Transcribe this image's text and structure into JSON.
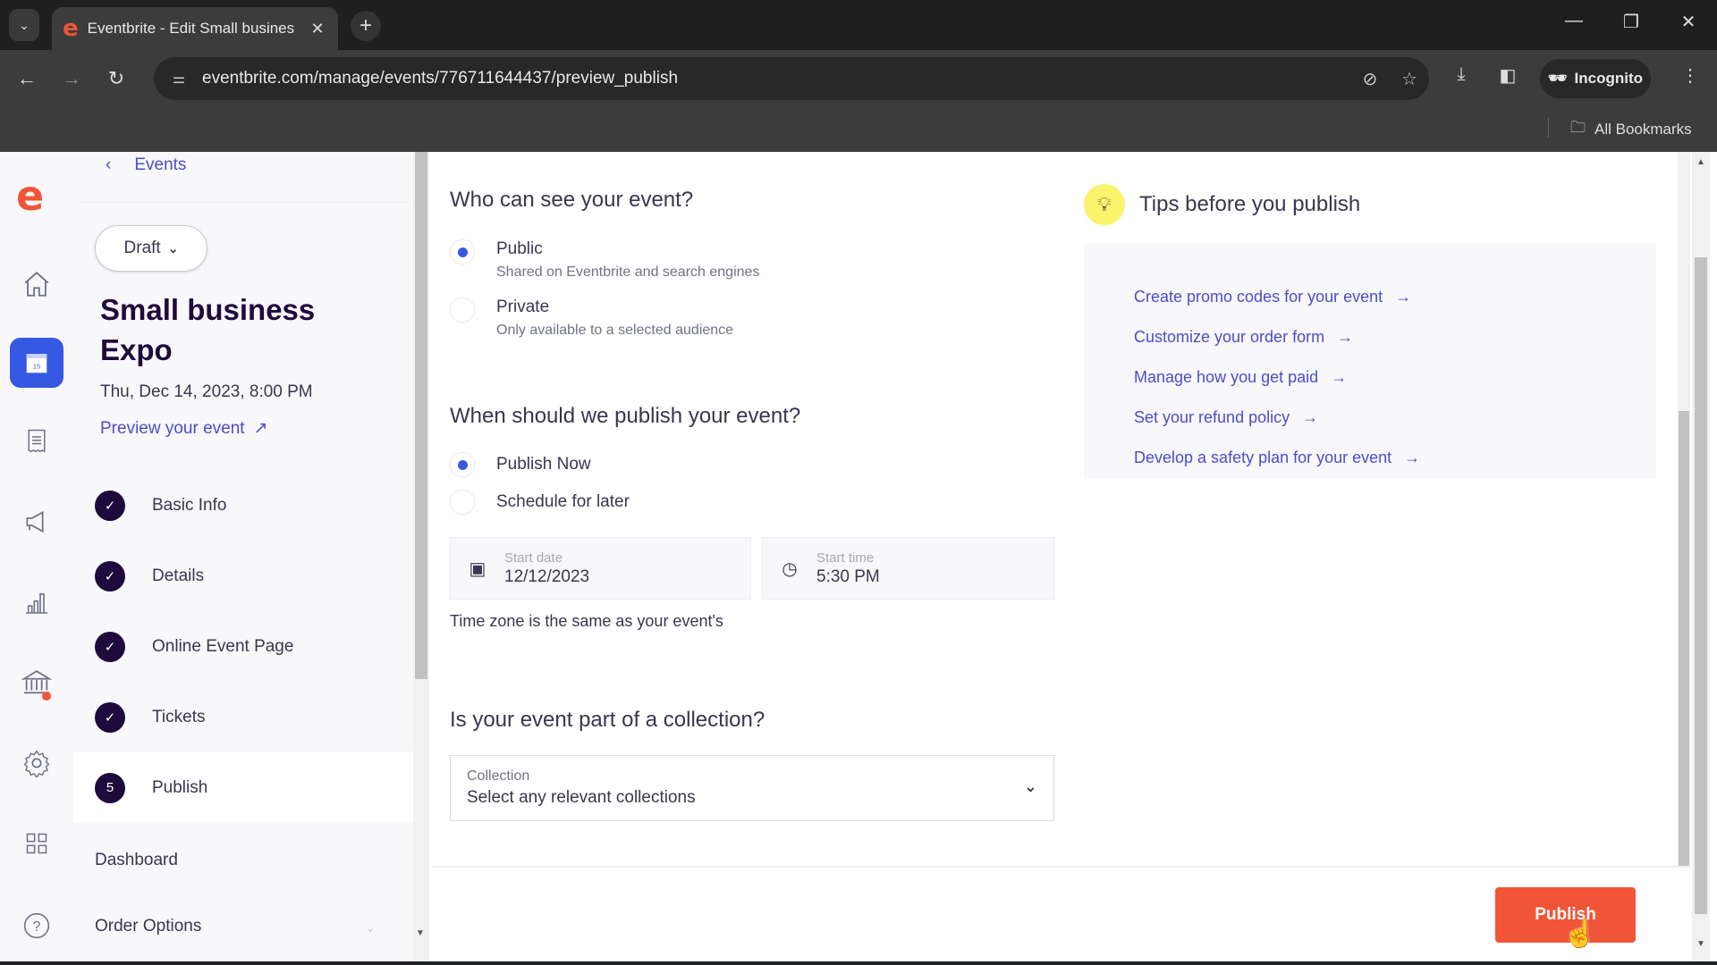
{
  "browser": {
    "tab_title": "Eventbrite - Edit Small busines",
    "tab_favicon": "e",
    "url": "eventbrite.com/manage/events/776711644437/preview_publish",
    "incognito_label": "Incognito",
    "bookmarks_label": "All Bookmarks",
    "icons": [
      "tab-search-icon",
      "close-icon",
      "new-tab-icon",
      "minimize-icon",
      "restore-icon",
      "close-window-icon",
      "back-icon",
      "forward-icon",
      "reload-icon",
      "site-info-icon",
      "eye-off-icon",
      "star-icon",
      "download-icon",
      "side-panel-icon",
      "incognito-icon",
      "menu-icon",
      "folder-icon"
    ]
  },
  "rail": {
    "logo": "e",
    "items": [
      {
        "name": "home",
        "icon": "⌂"
      },
      {
        "name": "events",
        "icon": "📅",
        "active": true
      },
      {
        "name": "orders",
        "icon": "☰"
      },
      {
        "name": "marketing",
        "icon": "📣"
      },
      {
        "name": "reporting",
        "icon": "📊"
      },
      {
        "name": "finance",
        "icon": "🏛",
        "badge": true
      },
      {
        "name": "settings",
        "icon": "⚙"
      },
      {
        "name": "apps",
        "icon": "▦"
      },
      {
        "name": "help",
        "icon": "?"
      }
    ]
  },
  "sidebar": {
    "back_label": "Events",
    "status": "Draft",
    "event_title": "Small business Expo",
    "event_date": "Thu, Dec 14, 2023, 8:00 PM",
    "preview_label": "Preview your event",
    "steps": [
      {
        "label": "Basic Info",
        "done": true,
        "marker": "✓"
      },
      {
        "label": "Details",
        "done": true,
        "marker": "✓"
      },
      {
        "label": "Online Event Page",
        "done": true,
        "marker": "✓"
      },
      {
        "label": "Tickets",
        "done": true,
        "marker": "✓"
      },
      {
        "label": "Publish",
        "done": false,
        "marker": "5",
        "active": true
      }
    ],
    "dashboard_label": "Dashboard",
    "order_options_label": "Order Options"
  },
  "main": {
    "visibility": {
      "heading": "Who can see your event?",
      "options": [
        {
          "label": "Public",
          "sub": "Shared on Eventbrite and search engines",
          "selected": true
        },
        {
          "label": "Private",
          "sub": "Only available to a selected audience",
          "selected": false
        }
      ]
    },
    "publish_time": {
      "heading": "When should we publish your event?",
      "options": [
        {
          "label": "Publish Now",
          "selected": true
        },
        {
          "label": "Schedule for later",
          "selected": false
        }
      ],
      "start_date_label": "Start date",
      "start_date_value": "12/12/2023",
      "start_time_label": "Start time",
      "start_time_value": "5:30 PM",
      "timezone_note": "Time zone is the same as your event's"
    },
    "collection": {
      "heading": "Is your event part of a collection?",
      "field_label": "Collection",
      "placeholder": "Select any relevant collections"
    },
    "tips": {
      "heading": "Tips before you publish",
      "links": [
        "Create promo codes for your event",
        "Customize your order form",
        "Manage how you get paid",
        "Set your refund policy",
        "Develop a safety plan for your event"
      ]
    }
  },
  "footer": {
    "publish_label": "Publish"
  },
  "colors": {
    "brand_orange": "#f05537",
    "accent_blue": "#3659e3",
    "link_blue": "#4b4dca",
    "dark_navy": "#1e0a3c"
  }
}
